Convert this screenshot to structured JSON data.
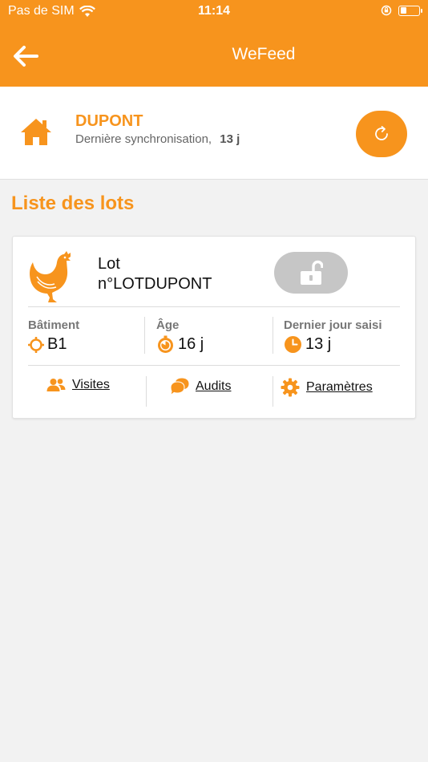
{
  "status_bar": {
    "carrier": "Pas de SIM",
    "time": "11:14"
  },
  "header": {
    "title": "WeFeed"
  },
  "farm": {
    "name": "DUPONT",
    "sync_label": "Dernière synchronisation,",
    "sync_value": "13 j"
  },
  "section": {
    "title": "Liste des lots"
  },
  "lot": {
    "line1": "Lot",
    "line2": "n°LOTDUPONT",
    "batiment_label": "Bâtiment",
    "batiment_value": "B1",
    "age_label": "Âge",
    "age_value": "16 j",
    "dernier_label": "Dernier jour saisi",
    "dernier_value": "13 j",
    "actions": {
      "visites": "Visites",
      "audits": "Audits",
      "parametres": "Paramètres"
    }
  },
  "colors": {
    "accent": "#f7941d",
    "lock_bg": "#c6c6c6"
  }
}
